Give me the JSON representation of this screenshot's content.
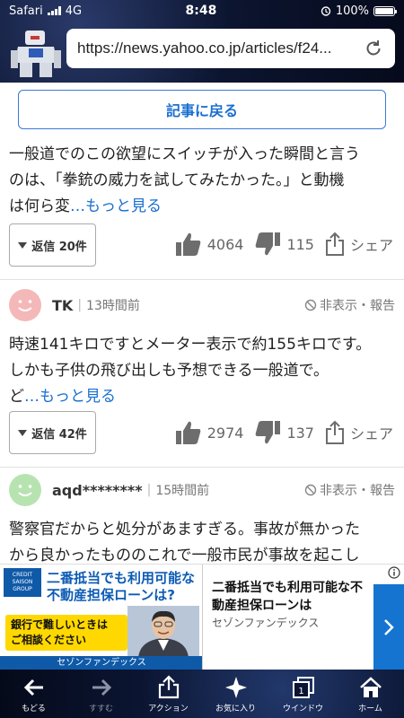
{
  "status_bar": {
    "carrier": "Safari",
    "network": "4G",
    "time": "8:48",
    "battery": "100%"
  },
  "browser": {
    "url": "https://news.yahoo.co.jp/articles/f24..."
  },
  "back_to_article": "記事に戻る",
  "comments": [
    {
      "text_lines": [
        "一般道でのこの欲望にスイッチが入った瞬間と言う",
        "のは、「拳銃の威力を試してみたかった。」と動機",
        "は何ら変"
      ],
      "more": "…もっと見る",
      "reply_label": "返信 20件",
      "likes": "4064",
      "dislikes": "115",
      "share": "シェア"
    },
    {
      "username": "TK",
      "posted": "13時間前",
      "hide_report": "非表示・報告",
      "avatar_color": "#f4b8b8",
      "text_lines": [
        "時速141キロですとメーター表示で約155キロです。",
        "しかも子供の飛び出しも予想できる一般道で。",
        "ど"
      ],
      "more": "…もっと見る",
      "reply_label": "返信 42件",
      "likes": "2974",
      "dislikes": "137",
      "share": "シェア"
    },
    {
      "username": "aqd********",
      "posted": "15時間前",
      "hide_report": "非表示・報告",
      "avatar_color": "#b7e3b0",
      "text_lines": [
        "警察官だからと処分があますぎる。事故が無かった",
        "から良かったもののこれで一般市民が事故を起こし"
      ]
    }
  ],
  "ad": {
    "logo": "CREDIT SAISON GROUP",
    "headline_lines": [
      "二番抵当でも利用可能な",
      "不動産担保ローンは?"
    ],
    "yellow_lines": [
      "銀行で難しいときは",
      "ご相談ください"
    ],
    "footer": "セゾンファンデックス",
    "title": "二番抵当でも利用可能な不動産担保ローンは",
    "advertiser": "セゾンファンデックス"
  },
  "toolbar": {
    "back": "もどる",
    "forward": "すすむ",
    "action": "アクション",
    "favorites": "お気に入り",
    "window": "ウインドウ",
    "window_count": "1",
    "home": "ホーム"
  },
  "colors": {
    "link": "#1a6fd0",
    "ad_blue": "#0f5aa8",
    "ad_yellow": "#ffd800"
  }
}
